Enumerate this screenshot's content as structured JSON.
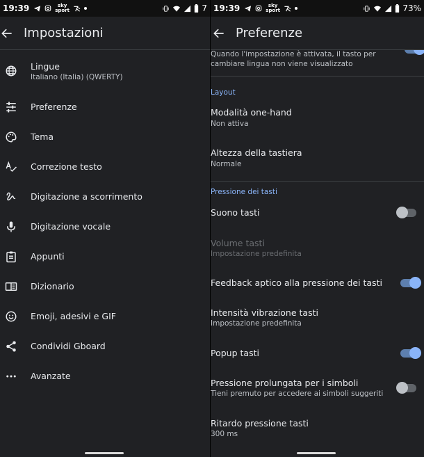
{
  "left": {
    "status": {
      "time": "19:39",
      "battery": "7"
    },
    "title": "Impostazioni",
    "items": [
      {
        "label": "Lingue",
        "sub": "Italiano (Italia) (QWERTY)"
      },
      {
        "label": "Preferenze"
      },
      {
        "label": "Tema"
      },
      {
        "label": "Correzione testo"
      },
      {
        "label": "Digitazione a scorrimento"
      },
      {
        "label": "Digitazione vocale"
      },
      {
        "label": "Appunti"
      },
      {
        "label": "Dizionario"
      },
      {
        "label": "Emoji, adesivi e GIF"
      },
      {
        "label": "Condividi Gboard"
      },
      {
        "label": "Avanzate"
      }
    ]
  },
  "right": {
    "status": {
      "time": "19:39",
      "battery": "73%"
    },
    "title": "Preferenze",
    "top_desc_line1": "Quando l'impostazione è attivata, il tasto per",
    "top_desc_line2": "cambiare lingua non viene visualizzato",
    "section_layout": "Layout",
    "one_hand": {
      "title": "Modalità one-hand",
      "sub": "Non attiva"
    },
    "height": {
      "title": "Altezza della tastiera",
      "sub": "Normale"
    },
    "section_keypress": "Pressione dei tasti",
    "key_sound": {
      "title": "Suono tasti",
      "on": false
    },
    "volume": {
      "title": "Volume tasti",
      "sub": "Impostazione predefinita"
    },
    "haptic": {
      "title": "Feedback aptico alla pressione dei tasti",
      "on": true
    },
    "vibration": {
      "title": "Intensità vibrazione tasti",
      "sub": "Impostazione predefinita"
    },
    "popup": {
      "title": "Popup tasti",
      "on": true
    },
    "long_press": {
      "title": "Pressione prolungata per i simboli",
      "sub": "Tieni premuto per accedere ai simboli suggeriti",
      "on": false
    },
    "delay": {
      "title": "Ritardo pressione tasti",
      "sub": "300 ms"
    }
  },
  "colors": {
    "background": "#202124",
    "accent": "#8ab4f8",
    "text": "#e8eaed"
  }
}
